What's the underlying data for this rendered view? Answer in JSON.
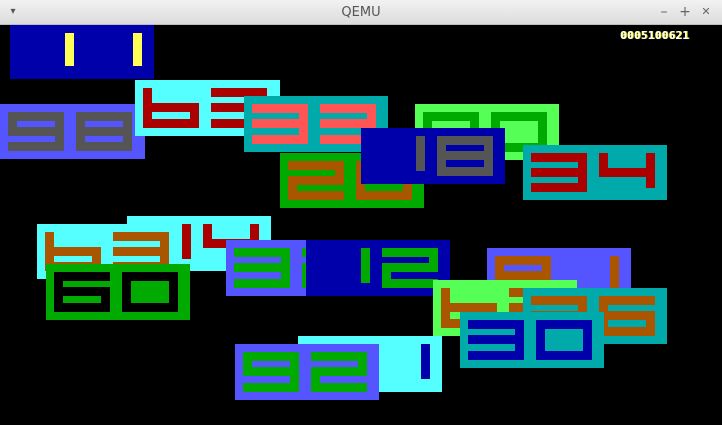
{
  "window": {
    "title": "QEMU",
    "menu_icon": "triangle-down-icon",
    "minimize_icon": "minimize-icon",
    "maximize_icon": "maximize-icon",
    "close_icon": "close-icon",
    "minimize_glyph": "–",
    "maximize_glyph": "+",
    "close_glyph": "✕",
    "menu_glyph": "▾"
  },
  "screen": {
    "counter": "0005100621",
    "background": "#000000"
  },
  "tiles": [
    {
      "bg": "#0000aa",
      "fg": "#ffff55",
      "text": "11"
    },
    {
      "bg": "#5555ff",
      "fg": "#555555",
      "text": "98"
    },
    {
      "bg": "#55ffff",
      "fg": "#aa0000",
      "text": "b3"
    },
    {
      "bg": "#00aaaa",
      "fg": "#ff5555",
      "text": "33"
    },
    {
      "bg": "#00aa00",
      "fg": "#aa5500",
      "text": "20"
    },
    {
      "bg": "#55ff55",
      "fg": "#00aa00",
      "text": "00"
    },
    {
      "bg": "#0000aa",
      "fg": "#555555",
      "text": "18"
    },
    {
      "bg": "#00aaaa",
      "fg": "#aa0000",
      "text": "34"
    },
    {
      "bg": "#55ffff",
      "fg": "#aa0000",
      "text": "14"
    },
    {
      "bg": "#55ffff",
      "fg": "#aa5500",
      "text": "b3"
    },
    {
      "bg": "#00aa00",
      "fg": "#000000",
      "text": "60"
    },
    {
      "bg": "#5555ff",
      "fg": "#00aa00",
      "text": "32"
    },
    {
      "bg": "#0000aa",
      "fg": "#00aa00",
      "text": "12"
    },
    {
      "bg": "#5555ff",
      "fg": "#aa5500",
      "text": "a1"
    },
    {
      "bg": "#55ff55",
      "fg": "#aa5500",
      "text": "b2"
    },
    {
      "bg": "#00aaaa",
      "fg": "#aa5500",
      "text": "36"
    },
    {
      "bg": "#00aaaa",
      "fg": "#0000aa",
      "text": "30"
    },
    {
      "bg": "#55ffff",
      "fg": "#0000aa",
      "text": "01"
    },
    {
      "bg": "#5555ff",
      "fg": "#00aa00",
      "text": "92"
    }
  ]
}
